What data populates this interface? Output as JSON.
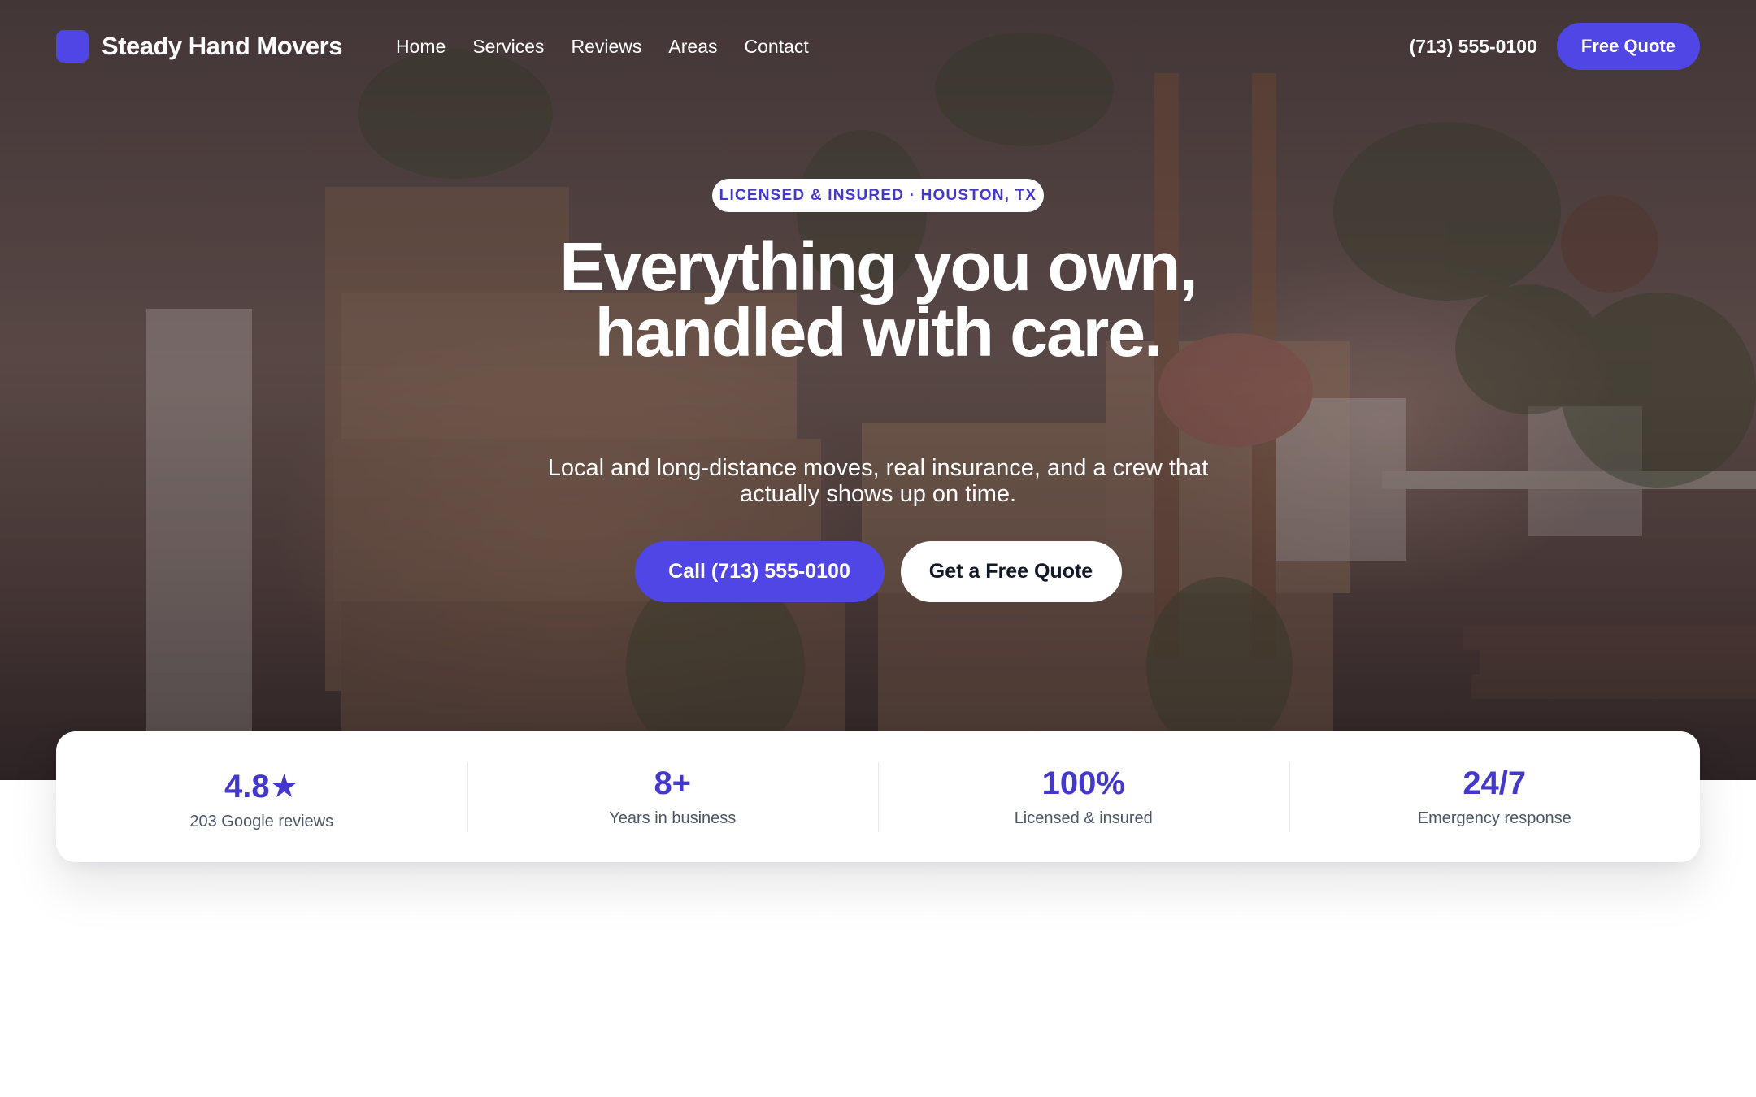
{
  "brand": {
    "name": "Steady Hand Movers",
    "accent": "#4f46e5"
  },
  "nav": {
    "links": [
      "Home",
      "Services",
      "Reviews",
      "Areas",
      "Contact"
    ],
    "phone": "(713) 555-0100",
    "cta": "Free Quote"
  },
  "hero": {
    "badge": "LICENSED & INSURED · HOUSTON, TX",
    "headline": "Everything you own, handled with care.",
    "subhead": "Local and long-distance moves, real insurance, and a crew that actually shows up on time.",
    "primary_cta": "Call (713) 555-0100",
    "secondary_cta": "Get a Free Quote"
  },
  "stats": [
    {
      "value": "4.8★",
      "label": "203 Google reviews"
    },
    {
      "value": "8+",
      "label": "Years in business"
    },
    {
      "value": "100%",
      "label": "Licensed & insured"
    },
    {
      "value": "24/7",
      "label": "Emergency response"
    }
  ]
}
